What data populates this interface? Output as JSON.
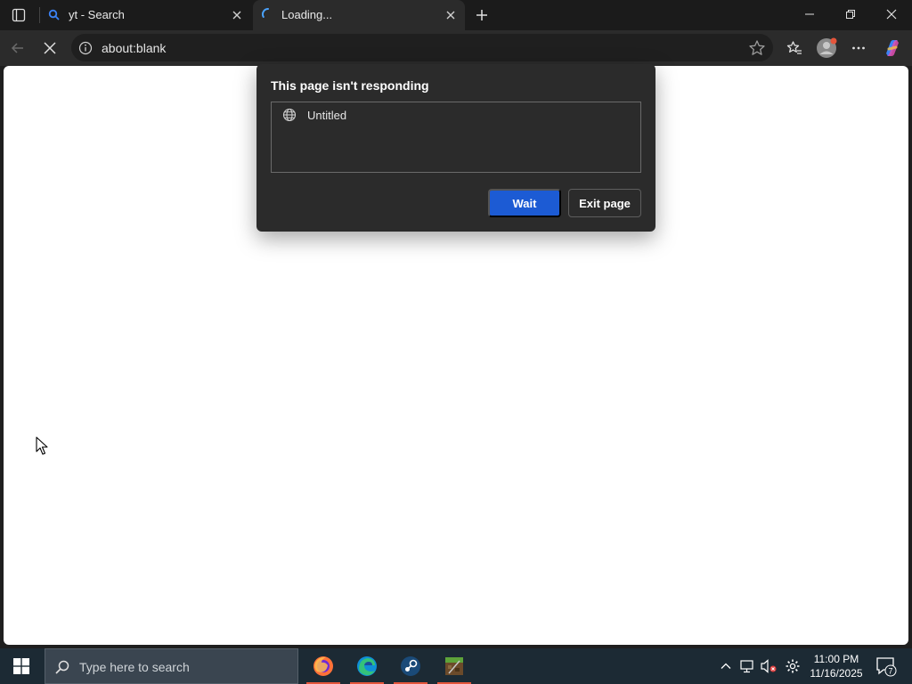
{
  "browser": {
    "tabs": [
      {
        "title": "yt - Search"
      },
      {
        "title": "Loading..."
      }
    ],
    "address": "about:blank"
  },
  "dialog": {
    "title": "This page isn't responding",
    "pages": [
      "Untitled"
    ],
    "wait_label": "Wait",
    "exit_label": "Exit page"
  },
  "taskbar": {
    "search_placeholder": "Type here to search",
    "apps": [
      "firefox-icon",
      "edge-icon",
      "steam-icon",
      "minecraft-icon"
    ],
    "time": "11:00 PM",
    "date": "11/16/2025",
    "notification_count": "7"
  },
  "colors": {
    "accent_button": "#1c5bd4",
    "dialog_bg": "#2b2b2b",
    "taskbar_bg": "#1c2a34"
  }
}
